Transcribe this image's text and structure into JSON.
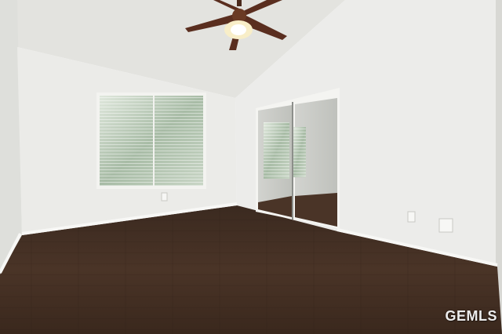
{
  "photo": {
    "subject": "empty-bedroom",
    "watermark": "GEMLS",
    "colors": {
      "wall": "#e9e9e6",
      "wall_shadow": "#dcdcd8",
      "ceiling": "#e3e3e0",
      "floor": "#3a2a20",
      "floor_light": "#5b4232",
      "baseboard": "#f6f6f4",
      "window_frame": "#f2f2ef",
      "blinds_glass": "#b9c8b8",
      "mirror": "#c9cbc6",
      "fan_blade": "#5a2e1f",
      "fan_light": "#f6e7b8"
    }
  }
}
